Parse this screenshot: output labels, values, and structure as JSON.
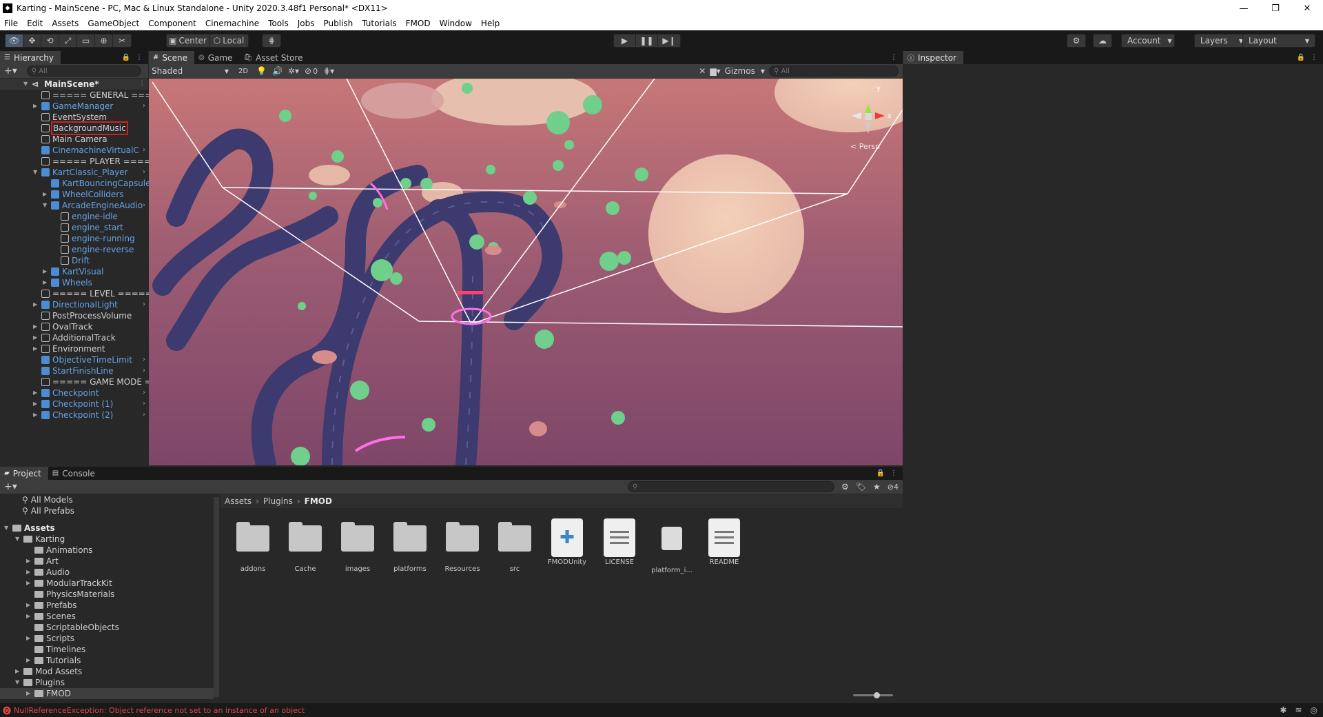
{
  "window": {
    "title": "Karting - MainScene - PC, Mac & Linux Standalone - Unity 2020.3.48f1 Personal* <DX11>"
  },
  "menu": [
    "File",
    "Edit",
    "Assets",
    "GameObject",
    "Component",
    "Cinemachine",
    "Tools",
    "Jobs",
    "Publish",
    "Tutorials",
    "FMOD",
    "Window",
    "Help"
  ],
  "toolbar": {
    "pivot": "Center",
    "space": "Local",
    "account": "Account",
    "layers": "Layers",
    "layout": "Layout"
  },
  "hierarchy": {
    "tab": "Hierarchy",
    "search_placeholder": "All",
    "scene_name": "MainScene*",
    "items": [
      {
        "label": "===== GENERAL =====",
        "indent": 1,
        "type": "plain",
        "arrow": "",
        "more": false
      },
      {
        "label": "GameManager",
        "indent": 1,
        "type": "prefab",
        "arrow": "right",
        "more": true
      },
      {
        "label": "EventSystem",
        "indent": 1,
        "type": "plain",
        "arrow": "",
        "more": false
      },
      {
        "label": "BackgroundMusic",
        "indent": 1,
        "type": "plain",
        "arrow": "",
        "more": false,
        "highlight": true
      },
      {
        "label": "Main Camera",
        "indent": 1,
        "type": "plain",
        "arrow": "",
        "more": false
      },
      {
        "label": "CinemachineVirtualC",
        "indent": 1,
        "type": "prefab",
        "arrow": "",
        "more": true
      },
      {
        "label": "===== PLAYER =====",
        "indent": 1,
        "type": "plain",
        "arrow": "",
        "more": false
      },
      {
        "label": "KartClassic_Player",
        "indent": 1,
        "type": "prefab",
        "arrow": "down",
        "more": true
      },
      {
        "label": "KartBouncingCapsule",
        "indent": 2,
        "type": "prefab",
        "arrow": "",
        "more": false
      },
      {
        "label": "WheelColliders",
        "indent": 2,
        "type": "prefab",
        "arrow": "right",
        "more": false
      },
      {
        "label": "ArcadeEngineAudio",
        "indent": 2,
        "type": "prefab",
        "arrow": "down",
        "more": true
      },
      {
        "label": "engine-idle",
        "indent": 3,
        "type": "prefab-text",
        "arrow": "",
        "more": false
      },
      {
        "label": "engine_start",
        "indent": 3,
        "type": "prefab-text",
        "arrow": "",
        "more": false
      },
      {
        "label": "engine-running",
        "indent": 3,
        "type": "prefab-text",
        "arrow": "",
        "more": false
      },
      {
        "label": "engine-reverse",
        "indent": 3,
        "type": "prefab-text",
        "arrow": "",
        "more": false
      },
      {
        "label": "Drift",
        "indent": 3,
        "type": "prefab-text",
        "arrow": "",
        "more": false
      },
      {
        "label": "KartVisual",
        "indent": 2,
        "type": "prefab",
        "arrow": "right",
        "more": false
      },
      {
        "label": "Wheels",
        "indent": 2,
        "type": "prefab",
        "arrow": "right",
        "more": false
      },
      {
        "label": "===== LEVEL =====",
        "indent": 1,
        "type": "plain",
        "arrow": "",
        "more": false
      },
      {
        "label": "DirectionalLight",
        "indent": 1,
        "type": "prefab",
        "arrow": "right",
        "more": true
      },
      {
        "label": "PostProcessVolume",
        "indent": 1,
        "type": "plain",
        "arrow": "",
        "more": false
      },
      {
        "label": "OvalTrack",
        "indent": 1,
        "type": "plain",
        "arrow": "right",
        "more": false
      },
      {
        "label": "AdditionalTrack",
        "indent": 1,
        "type": "plain",
        "arrow": "right",
        "more": false
      },
      {
        "label": "Environment",
        "indent": 1,
        "type": "plain",
        "arrow": "right",
        "more": false
      },
      {
        "label": "ObjectiveTimeLimit",
        "indent": 1,
        "type": "prefab",
        "arrow": "",
        "more": true
      },
      {
        "label": "StartFinishLine",
        "indent": 1,
        "type": "prefab",
        "arrow": "",
        "more": true
      },
      {
        "label": "===== GAME MODE =====",
        "indent": 1,
        "type": "plain",
        "arrow": "",
        "more": false
      },
      {
        "label": "Checkpoint",
        "indent": 1,
        "type": "prefab",
        "arrow": "right",
        "more": true
      },
      {
        "label": "Checkpoint (1)",
        "indent": 1,
        "type": "prefab",
        "arrow": "right",
        "more": true
      },
      {
        "label": "Checkpoint (2)",
        "indent": 1,
        "type": "prefab",
        "arrow": "right",
        "more": true
      }
    ]
  },
  "scene_view": {
    "tabs": [
      "Scene",
      "Game",
      "Asset Store"
    ],
    "draw_mode": "Shaded",
    "mode_2d": "2D",
    "hidden_count": "0",
    "gizmos": "Gizmos",
    "search_placeholder": "All",
    "persp_label": "< Persp",
    "axis_y": "y",
    "axis_x": "x"
  },
  "inspector": {
    "tab": "Inspector"
  },
  "project": {
    "tabs": [
      "Project",
      "Console"
    ],
    "hidden_count": "4",
    "favorites": [
      "All Models",
      "All Prefabs"
    ],
    "tree": [
      {
        "label": "Assets",
        "indent": 0,
        "arrow": "down",
        "bold": true
      },
      {
        "label": "Karting",
        "indent": 1,
        "arrow": "down"
      },
      {
        "label": "Animations",
        "indent": 2,
        "arrow": ""
      },
      {
        "label": "Art",
        "indent": 2,
        "arrow": "right"
      },
      {
        "label": "Audio",
        "indent": 2,
        "arrow": "right"
      },
      {
        "label": "ModularTrackKit",
        "indent": 2,
        "arrow": "right"
      },
      {
        "label": "PhysicsMaterials",
        "indent": 2,
        "arrow": ""
      },
      {
        "label": "Prefabs",
        "indent": 2,
        "arrow": "right"
      },
      {
        "label": "Scenes",
        "indent": 2,
        "arrow": "right"
      },
      {
        "label": "ScriptableObjects",
        "indent": 2,
        "arrow": ""
      },
      {
        "label": "Scripts",
        "indent": 2,
        "arrow": "right"
      },
      {
        "label": "Timelines",
        "indent": 2,
        "arrow": ""
      },
      {
        "label": "Tutorials",
        "indent": 2,
        "arrow": "right"
      },
      {
        "label": "Mod Assets",
        "indent": 1,
        "arrow": "right"
      },
      {
        "label": "Plugins",
        "indent": 1,
        "arrow": "down"
      },
      {
        "label": "FMOD",
        "indent": 2,
        "arrow": "right",
        "selected": true
      }
    ],
    "breadcrumb": [
      "Assets",
      "Plugins",
      "FMOD"
    ],
    "assets": [
      {
        "name": "addons",
        "kind": "folder"
      },
      {
        "name": "Cache",
        "kind": "folder"
      },
      {
        "name": "images",
        "kind": "folder"
      },
      {
        "name": "platforms",
        "kind": "folder"
      },
      {
        "name": "Resources",
        "kind": "folder"
      },
      {
        "name": "src",
        "kind": "folder"
      },
      {
        "name": "FMODUnity",
        "kind": "asmdef"
      },
      {
        "name": "LICENSE",
        "kind": "text"
      },
      {
        "name": "platform_i...",
        "kind": "plugin"
      },
      {
        "name": "README",
        "kind": "text"
      }
    ]
  },
  "status": {
    "error": "NullReferenceException: Object reference not set to an instance of an object"
  },
  "colors": {
    "accent": "#4a5b70",
    "prefab": "#64a5e8",
    "error": "#e04848",
    "highlight_box": "#d42020"
  }
}
